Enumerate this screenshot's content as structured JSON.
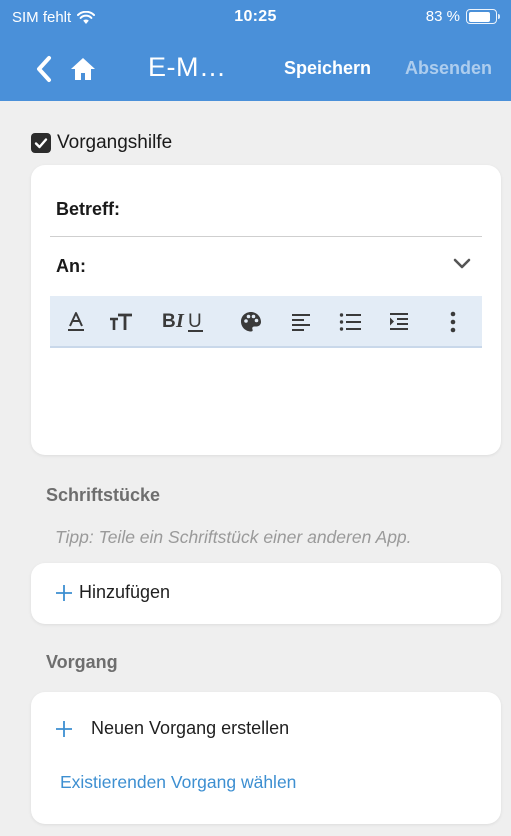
{
  "status_bar": {
    "carrier": "SIM fehlt",
    "time": "10:25",
    "battery": "83 %",
    "battery_level": 0.83,
    "wifi_icon": "wifi-icon"
  },
  "nav": {
    "back_icon": "chevron-left-icon",
    "home_icon": "home-icon",
    "title": "E-M…",
    "save_label": "Speichern",
    "send_label": "Absenden"
  },
  "vorgangshilfe": {
    "label": "Vorgangshilfe",
    "checked": true
  },
  "mail": {
    "subject_label": "Betreff:",
    "to_label": "An:",
    "to_dropdown_icon": "chevron-down-icon",
    "toolbar_icons": [
      "font-color-icon",
      "text-size-icon",
      "bold-italic-underline-icon",
      "palette-icon",
      "align-left-icon",
      "bullet-list-icon",
      "indent-icon",
      "more-vertical-icon"
    ]
  },
  "documents": {
    "title": "Schriftstücke",
    "hint": "Tipp: Teile ein Schriftstück einer anderen App.",
    "add_label": "Hinzufügen"
  },
  "process": {
    "title": "Vorgang",
    "create_label": "Neuen Vorgang erstellen",
    "choose_label": "Existierenden Vorgang wählen"
  },
  "colors": {
    "header": "#4a90d9",
    "background": "#efefef",
    "link": "#3d8fd1",
    "toolbar": "#e3ecf6"
  }
}
